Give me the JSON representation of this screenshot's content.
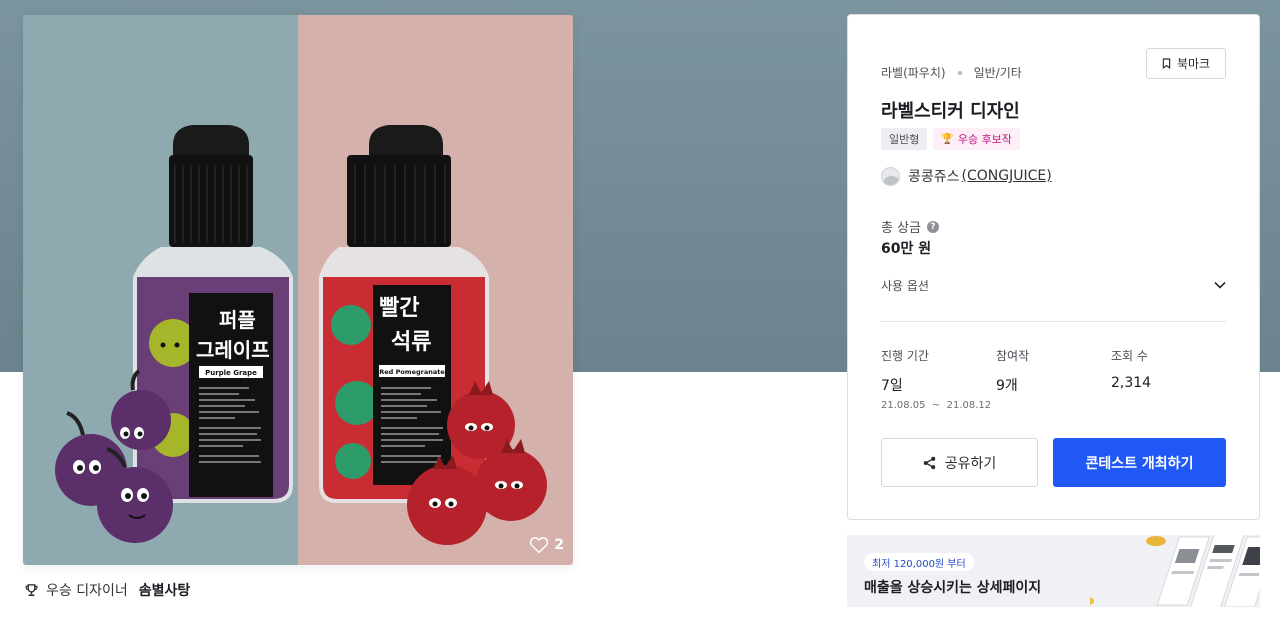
{
  "product": {
    "like_count": "2",
    "bottle_left": {
      "title_line1": "퍼플",
      "title_line2": "그레이프",
      "subtitle": "Purple Grape",
      "label_color": "#111111",
      "liquid_color": "#6a3f78"
    },
    "bottle_right": {
      "title_line1": "빨간",
      "title_line2": "석류",
      "subtitle": "Red Pomegranate",
      "label_color": "#111111",
      "liquid_color": "#c92d33"
    },
    "bg_left": "#8fa9b0",
    "bg_right": "#d5b1ab"
  },
  "winner": {
    "prefix": "우승 디자이너",
    "name": "솜별사탕",
    "icon": "trophy-icon"
  },
  "contest": {
    "breadcrumb": [
      "라벨(파우치)",
      "일반/기타"
    ],
    "bookmark_label": "북마크",
    "title": "라벨스티커 디자인",
    "badges": {
      "type": "일반형",
      "winner": "우승 후보작"
    },
    "host": {
      "name": "콩콩쥬스",
      "handle": "(CONGJUICE)"
    },
    "prize_label": "총 상금",
    "prize_value": "60만 원",
    "options_label": "사용 옵션",
    "stats": {
      "period_label": "진행 기간",
      "period_value": "7일",
      "period_dates": "21.08.05  ~  21.08.12",
      "participants_label": "참여작",
      "participants_value": "9개",
      "views_label": "조회 수",
      "views_value": "2,314"
    },
    "share_label": "공유하기",
    "host_contest_label": "콘테스트 개최하기"
  },
  "ad": {
    "chip": "최저 120,000원 부터",
    "text": "매출을 상승시키는 상세페이지"
  },
  "colors": {
    "accent": "#1f58f5",
    "winner_badge": "#c1177f",
    "hero_bg": "#7b949e"
  }
}
